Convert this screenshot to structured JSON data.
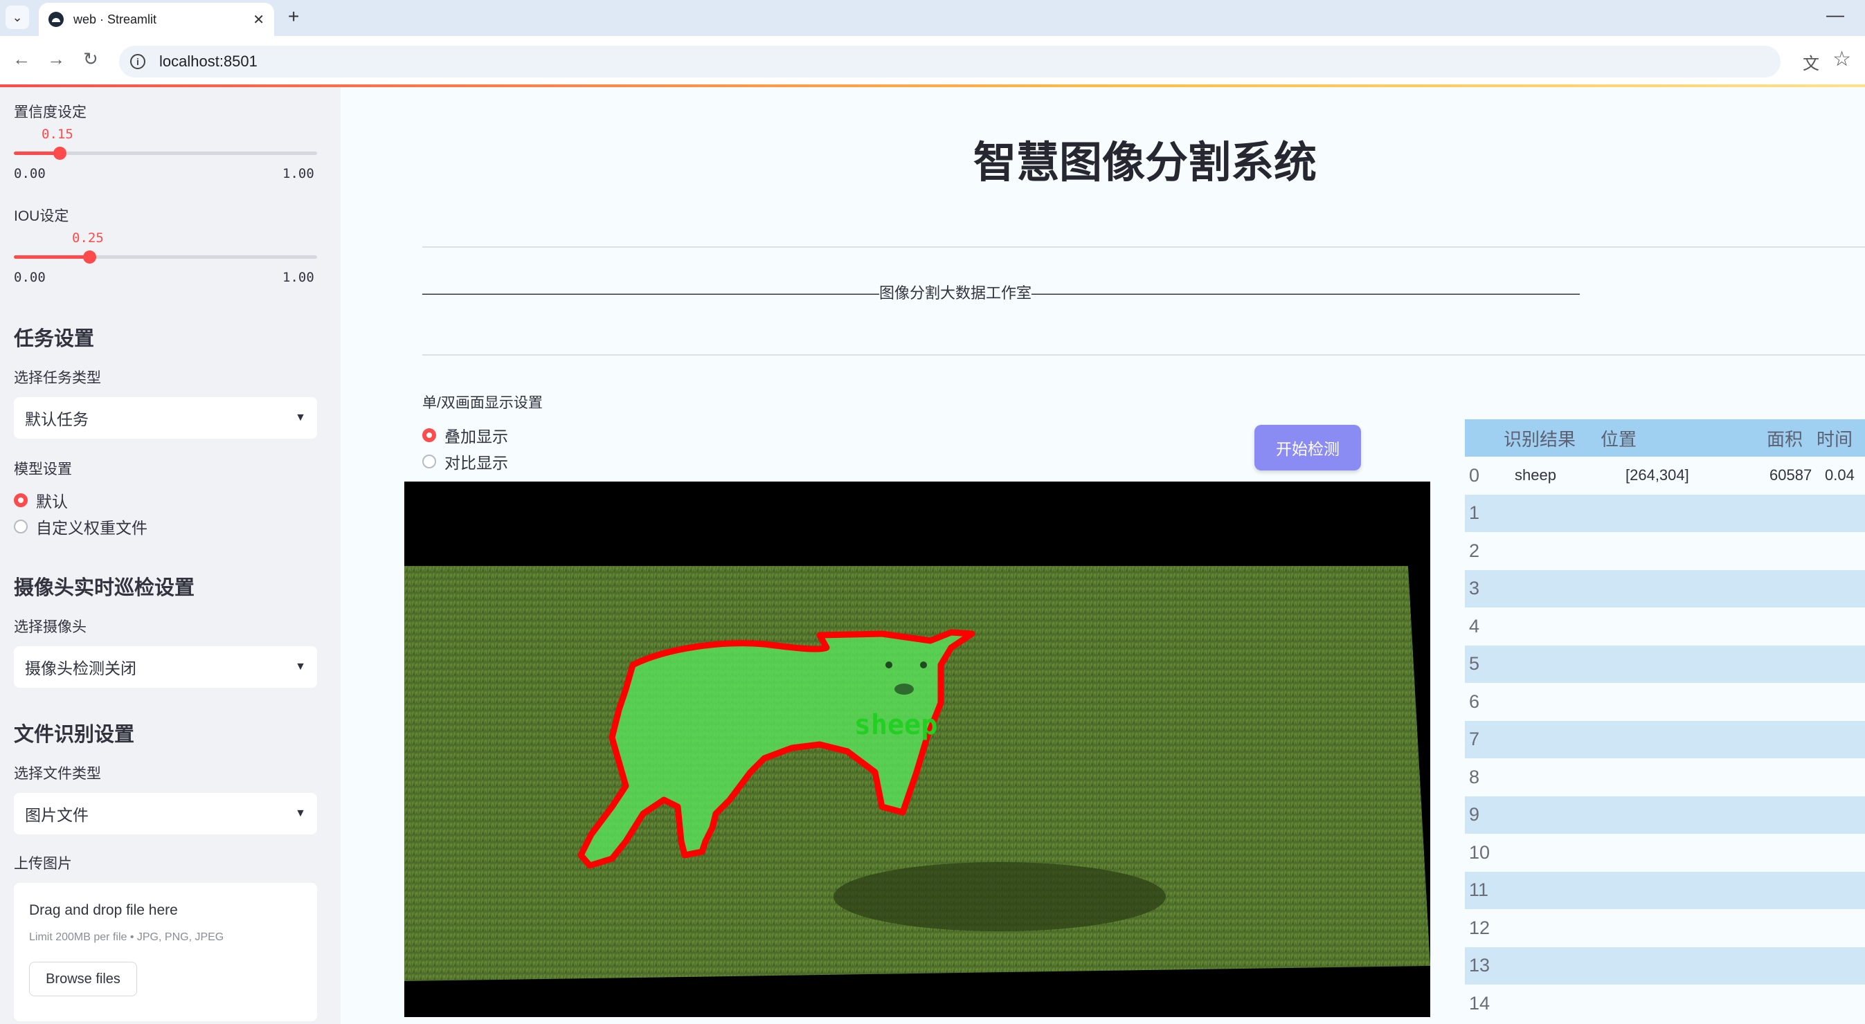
{
  "browser": {
    "tab_title": "web · Streamlit",
    "url": "localhost:8501"
  },
  "sidebar": {
    "confidence": {
      "label": "置信度设定",
      "value": "0.15",
      "value_fraction": 0.15,
      "min": "0.00",
      "max": "1.00"
    },
    "iou": {
      "label": "IOU设定",
      "value": "0.25",
      "value_fraction": 0.25,
      "min": "0.00",
      "max": "1.00"
    },
    "task_heading": "任务设置",
    "task_type_label": "选择任务类型",
    "task_type_value": "默认任务",
    "model_label": "模型设置",
    "model_options": [
      "默认",
      "自定义权重文件"
    ],
    "model_selected": "默认",
    "camera_heading": "摄像头实时巡检设置",
    "camera_label": "选择摄像头",
    "camera_value": "摄像头检测关闭",
    "file_heading": "文件识别设置",
    "file_type_label": "选择文件类型",
    "file_type_value": "图片文件",
    "upload_label": "上传图片",
    "upload_title": "Drag and drop file here",
    "upload_limit": "Limit 200MB per file • JPG, PNG, JPEG",
    "browse_label": "Browse files"
  },
  "main": {
    "title": "智慧图像分割系统",
    "studio_line": "——————————————————————————————图像分割大数据工作室————————————————————————————————————",
    "display_label": "单/双画面显示设置",
    "display_options": [
      "叠加显示",
      "对比显示"
    ],
    "display_selected": "叠加显示",
    "start_button": "开始检测",
    "detection_label": "sheep"
  },
  "table": {
    "headers": [
      "识别结果",
      "位置",
      "面积",
      "时间"
    ],
    "rows": [
      {
        "index": "0",
        "result": "sheep",
        "position": "[264,304]",
        "area": "60587",
        "time": "0.04"
      },
      {
        "index": "1"
      },
      {
        "index": "2"
      },
      {
        "index": "3"
      },
      {
        "index": "4"
      },
      {
        "index": "5"
      },
      {
        "index": "6"
      },
      {
        "index": "7"
      },
      {
        "index": "8"
      },
      {
        "index": "9"
      },
      {
        "index": "10"
      },
      {
        "index": "11"
      },
      {
        "index": "12"
      },
      {
        "index": "13"
      },
      {
        "index": "14"
      }
    ]
  },
  "colors": {
    "accent": "#ff4b4b",
    "button": "#8b8cf3",
    "table_stripe": "#cfe6f7",
    "table_header": "#9fd0f2",
    "mask": "#59e05a"
  }
}
